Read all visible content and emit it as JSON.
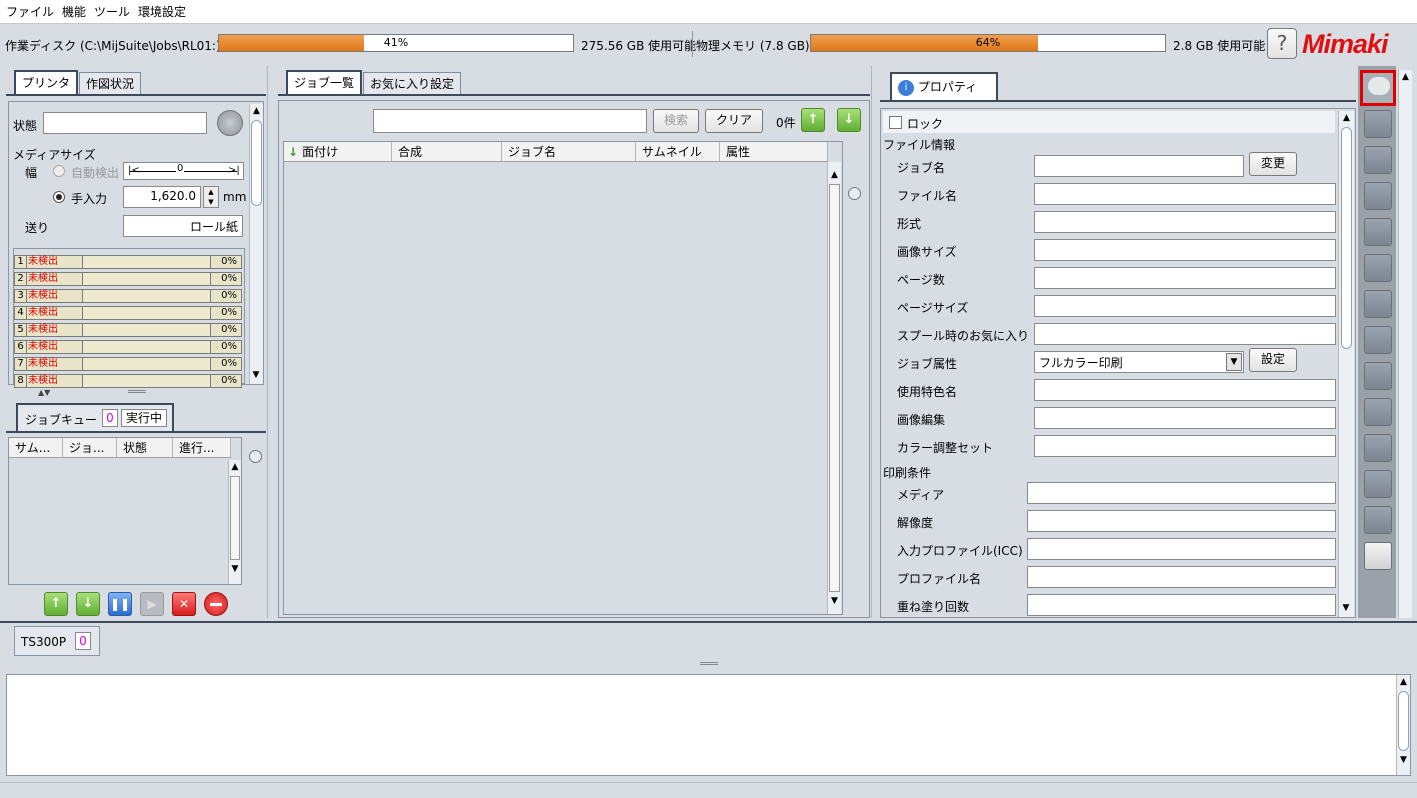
{
  "menu": [
    "ファイル",
    "機能",
    "ツール",
    "環境設定"
  ],
  "status": {
    "disk_label": "作業ディスク (C:\\MijSuite\\Jobs\\RL01:)",
    "disk_percent_text": "41%",
    "disk_percent": 41,
    "disk_free": "275.56 GB 使用可能",
    "mem_label": "物理メモリ (7.8 GB)",
    "mem_percent_text": "64%",
    "mem_percent": 64,
    "mem_free": "2.8 GB 使用可能",
    "help": "?",
    "logo": "Mimaki"
  },
  "printer_panel": {
    "tabs": [
      "プリンタ",
      "作図状況"
    ],
    "state_label": "状態",
    "state_value": "",
    "media_size_label": "メディアサイズ",
    "width_label": "幅",
    "auto_detect_label": "自動検出",
    "auto_detect_value": "0",
    "manual_label": "手入力",
    "manual_value": "1,620.0",
    "unit": "mm",
    "feed_label": "送り",
    "feed_value": "ロール紙",
    "ink_slots": [
      {
        "num": "1",
        "state": "未検出",
        "pct": "0%"
      },
      {
        "num": "2",
        "state": "未検出",
        "pct": "0%"
      },
      {
        "num": "3",
        "state": "未検出",
        "pct": "0%"
      },
      {
        "num": "4",
        "state": "未検出",
        "pct": "0%"
      },
      {
        "num": "5",
        "state": "未検出",
        "pct": "0%"
      },
      {
        "num": "6",
        "state": "未検出",
        "pct": "0%"
      },
      {
        "num": "7",
        "state": "未検出",
        "pct": "0%"
      },
      {
        "num": "8",
        "state": "未検出",
        "pct": "0%"
      }
    ]
  },
  "queue_panel": {
    "tab_label": "ジョブキュー",
    "queue_count": "0",
    "running_label": "実行中",
    "columns": [
      "サム...",
      "ジョ...",
      "状態",
      "進行..."
    ]
  },
  "job_panel": {
    "tabs": [
      "ジョブ一覧",
      "お気に入り設定"
    ],
    "search_value": "",
    "search_button": "検索",
    "clear_button": "クリア",
    "count": "0件",
    "columns": [
      "面付け",
      "合成",
      "ジョブ名",
      "サムネイル",
      "属性"
    ]
  },
  "property_panel": {
    "tab_label": "プロパティ",
    "lock_label": "ロック",
    "file_info_header": "ファイル情報",
    "change_button": "変更",
    "settings_button": "設定",
    "file_fields": [
      {
        "label": "ジョブ名",
        "value": ""
      },
      {
        "label": "ファイル名",
        "value": ""
      },
      {
        "label": "形式",
        "value": ""
      },
      {
        "label": "画像サイズ",
        "value": ""
      },
      {
        "label": "ページ数",
        "value": ""
      },
      {
        "label": "ページサイズ",
        "value": ""
      },
      {
        "label": "スプール時のお気に入り",
        "value": ""
      },
      {
        "label": "ジョブ属性",
        "value": "フルカラー印刷"
      },
      {
        "label": "使用特色名",
        "value": ""
      },
      {
        "label": "画像編集",
        "value": ""
      },
      {
        "label": "カラー調整セット",
        "value": ""
      }
    ],
    "print_header": "印刷条件",
    "print_fields": [
      {
        "label": "メディア",
        "value": ""
      },
      {
        "label": "解像度",
        "value": ""
      },
      {
        "label": "入力プロファイル(ICC)",
        "value": ""
      },
      {
        "label": "プロファイル名",
        "value": ""
      },
      {
        "label": "重ね塗り回数",
        "value": ""
      }
    ]
  },
  "bottom": {
    "printer_tab": "TS300P",
    "printer_count": "0"
  },
  "colors": {
    "progress": "#e07818",
    "logo": "#e01010",
    "error": "#e00000",
    "green_button": "#5fae32",
    "highlight": "#e00000"
  }
}
